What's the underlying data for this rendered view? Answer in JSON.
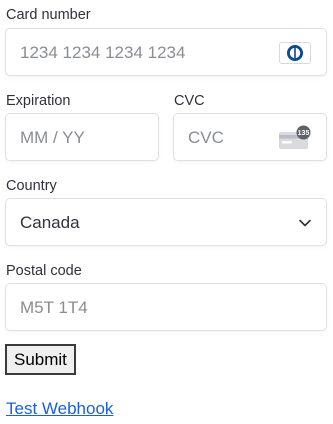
{
  "card_number": {
    "label": "Card number",
    "placeholder": "1234 1234 1234 1234",
    "brand_icon": "diners-club-card-icon"
  },
  "expiration": {
    "label": "Expiration",
    "placeholder": "MM / YY"
  },
  "cvc": {
    "label": "CVC",
    "placeholder": "CVC",
    "icon": "cvc-card-icon",
    "icon_badge": "135"
  },
  "country": {
    "label": "Country",
    "selected": "Canada",
    "icon": "chevron-down-icon"
  },
  "postal_code": {
    "label": "Postal code",
    "placeholder": "M5T 1T4"
  },
  "submit_label": "Submit",
  "webhook_link": "Test Webhook",
  "colors": {
    "text": "#30313d",
    "placeholder": "#8a8d93",
    "border": "#e0e0e0",
    "link": "#1a5ee6",
    "brand_blue": "#0a4a8f"
  }
}
